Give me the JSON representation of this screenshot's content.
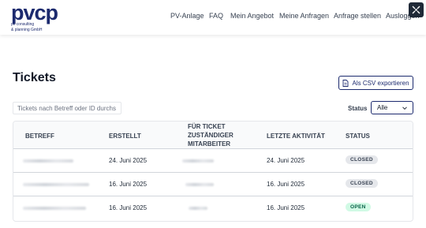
{
  "header": {
    "logo_text": "pvcp",
    "logo_subtext_1": "pv consulting",
    "logo_subtext_2": "& planning GmbH",
    "nav": [
      {
        "label": "PV-Anlage"
      },
      {
        "label": "FAQ"
      },
      {
        "label": "Mein Angebot"
      },
      {
        "label": "Meine Anfragen"
      },
      {
        "label": "Anfrage stellen"
      },
      {
        "label": "Ausloggen"
      }
    ]
  },
  "page": {
    "title": "Tickets",
    "export_label": "Als CSV exportieren"
  },
  "filters": {
    "search_placeholder": "Tickets nach Betreff oder ID durchs",
    "status_label": "Status",
    "status_value": "Alle"
  },
  "table": {
    "columns": [
      "Betreff",
      "Erstellt",
      "Für Ticket zuständiger Mitarbeiter",
      "Letzte Aktivität",
      "Status"
    ],
    "rows": [
      {
        "created": "24. Juni 2025",
        "last_activity": "24. Juni 2025",
        "status": "CLOSED"
      },
      {
        "created": "16. Juni 2025",
        "last_activity": "16. Juni 2025",
        "status": "CLOSED"
      },
      {
        "created": "16. Juni 2025",
        "last_activity": "16. Juni 2025",
        "status": "OPEN"
      }
    ]
  },
  "colors": {
    "brand": "#1c2a6e",
    "accent": "#f28c28",
    "open_badge_bg": "#d1fae5",
    "closed_badge_bg": "#e5e7eb"
  }
}
